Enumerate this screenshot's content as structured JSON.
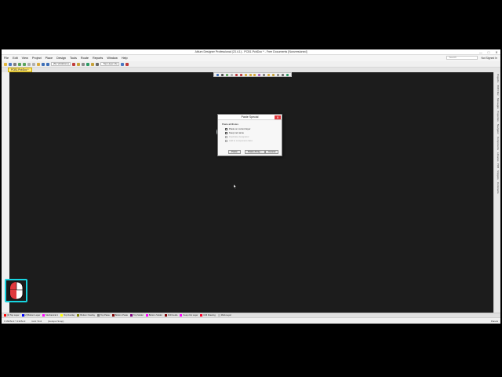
{
  "window": {
    "title": "Altium Designer Professional (23.4.1) - PCB1.PcbDoc * - Free Documents [Nonversioned]",
    "controls": [
      "—",
      "□",
      "✕"
    ]
  },
  "menubar": {
    "items": [
      "File",
      "Edit",
      "View",
      "Project",
      "Place",
      "Design",
      "Tools",
      "Route",
      "Reports",
      "Window",
      "Help"
    ],
    "search_placeholder": "Search",
    "signin": "Not Signed In"
  },
  "toolbar": {
    "variant_combo": "[No Variations]",
    "layer_combo": "Top Layer (S)"
  },
  "doc_tab": "PCB1.PcbDoc *",
  "right_panel": {
    "tabs": [
      "Projects",
      "PCB Filter",
      "Messages",
      "Properties",
      "Navigator",
      "Components",
      "Libraries",
      "PCB",
      "Snippets",
      "Comments"
    ]
  },
  "dialog": {
    "title": "Paste Special",
    "close": "✕",
    "group_label": "Paste attributes",
    "options": [
      {
        "label": "Paste on current layer",
        "checked": false,
        "enabled": true
      },
      {
        "label": "Keep net name",
        "checked": false,
        "enabled": true
      },
      {
        "label": "Duplicate designator",
        "checked": false,
        "enabled": false
      },
      {
        "label": "Add to component class",
        "checked": false,
        "enabled": false
      }
    ],
    "buttons": {
      "paste": "Paste",
      "paste_array": "Paste Array...",
      "cancel": "Cancel"
    }
  },
  "layers": [
    {
      "name": "[1] Top Layer",
      "color": "#ff0000"
    },
    {
      "name": "[2] Bottom Layer",
      "color": "#0000ff"
    },
    {
      "name": "Mechanical 1",
      "color": "#ff00ff"
    },
    {
      "name": "Top Overlay",
      "color": "#ffff00"
    },
    {
      "name": "Bottom Overlay",
      "color": "#808000"
    },
    {
      "name": "Top Paste",
      "color": "#808080"
    },
    {
      "name": "Bottom Paste",
      "color": "#800000"
    },
    {
      "name": "Top Solder",
      "color": "#800080"
    },
    {
      "name": "Bottom Solder",
      "color": "#ff00ff"
    },
    {
      "name": "Drill Guide",
      "color": "#800000"
    },
    {
      "name": "Keep-Out Layer",
      "color": "#ff00ff"
    },
    {
      "name": "Drill Drawing",
      "color": "#ff002a"
    },
    {
      "name": "Multi-Layer",
      "color": "#c0c0c0"
    }
  ],
  "status": {
    "coords": "X:3935mil Y:1325mil",
    "grid": "Grid: 5mil",
    "snap": "(Hotspot Snap)",
    "right": "Panels"
  },
  "colors": {
    "canvas": "#1c1c1c",
    "accent_cyan": "#17d4e0",
    "mouse_left": "#e0393e",
    "doc_tab": "#ffe979"
  }
}
